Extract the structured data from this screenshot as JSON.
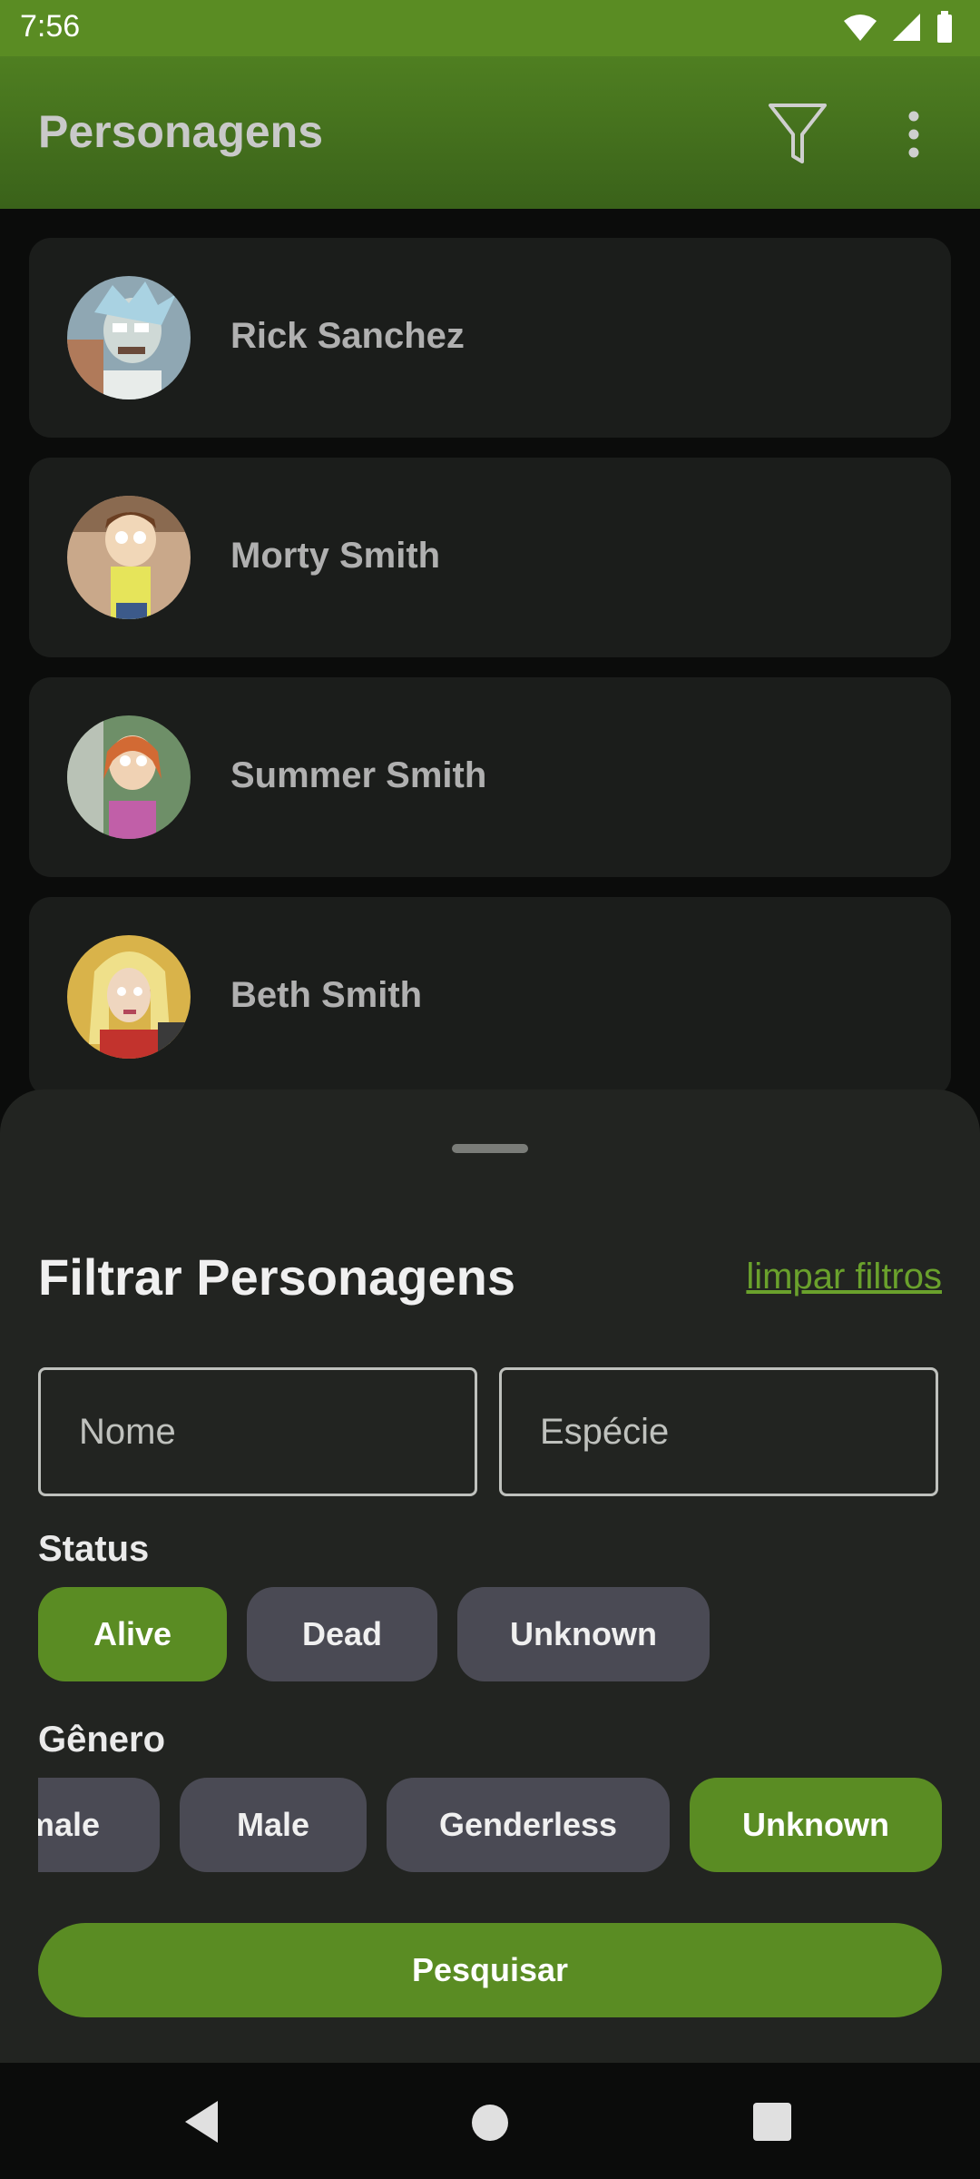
{
  "status_bar": {
    "time": "7:56"
  },
  "app_bar": {
    "title": "Personagens"
  },
  "characters": [
    {
      "name": "Rick Sanchez"
    },
    {
      "name": "Morty Smith"
    },
    {
      "name": "Summer Smith"
    },
    {
      "name": "Beth Smith"
    }
  ],
  "filter_sheet": {
    "title": "Filtrar Personagens",
    "clear_label": "limpar filtros",
    "name_placeholder": "Nome",
    "species_placeholder": "Espécie",
    "status_label": "Status",
    "status_options": [
      {
        "label": "Alive",
        "selected": true
      },
      {
        "label": "Dead",
        "selected": false
      },
      {
        "label": "Unknown",
        "selected": false
      }
    ],
    "gender_label": "Gênero",
    "gender_options": [
      {
        "label": "Female",
        "selected": false
      },
      {
        "label": "Male",
        "selected": false
      },
      {
        "label": "Genderless",
        "selected": false
      },
      {
        "label": "Unknown",
        "selected": true
      }
    ],
    "search_label": "Pesquisar"
  },
  "colors": {
    "accent": "#5a8c23",
    "chip": "#4a4a54",
    "card": "#1b1d1b",
    "sheet": "#222421"
  }
}
